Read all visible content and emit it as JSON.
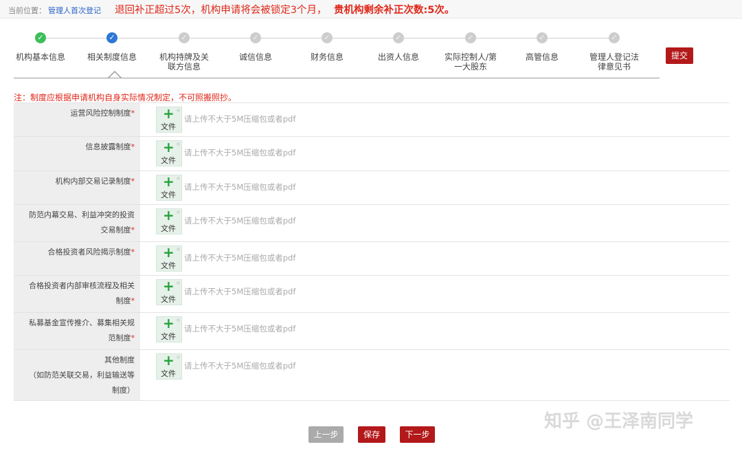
{
  "breadcrumb": {
    "label": "当前位置：",
    "link": "管理人首次登记"
  },
  "alert": {
    "text": "退回补正超过5次，机构申请将会被锁定3个月，",
    "strong": "贵机构剩余补正次数:5次。"
  },
  "steps": [
    {
      "label": "机构基本信息",
      "status": "done"
    },
    {
      "label": "相关制度信息",
      "status": "current"
    },
    {
      "label": "机构持牌及关\n联方信息",
      "status": "todo"
    },
    {
      "label": "诚信信息",
      "status": "todo"
    },
    {
      "label": "财务信息",
      "status": "todo"
    },
    {
      "label": "出资人信息",
      "status": "todo"
    },
    {
      "label": "实际控制人/第\n一大股东",
      "status": "todo"
    },
    {
      "label": "高管信息",
      "status": "todo"
    },
    {
      "label": "管理人登记法\n律意见书",
      "status": "todo"
    }
  ],
  "submit_label": "提交",
  "note": "注：制度应根据申请机构自身实际情况制定，不可照搬照抄。",
  "upload": {
    "plus": "+",
    "file_label": "文件",
    "hint": "请上传不大于5M压缩包或者pdf"
  },
  "rows": [
    {
      "label": "运营风险控制制度",
      "required": "*"
    },
    {
      "label": "信息披露制度",
      "required": "*"
    },
    {
      "label": "机构内部交易记录制度",
      "required": "*"
    },
    {
      "label": "防范内幕交易、利益冲突的投资\n交易制度",
      "required": "*"
    },
    {
      "label": "合格投资者风险揭示制度",
      "required": "*"
    },
    {
      "label": "合格投资者内部审核流程及相关\n制度",
      "required": "*"
    },
    {
      "label": "私募基金宣传推介、募集相关规\n范制度",
      "required": "*"
    },
    {
      "label": "其他制度\n（如防范关联交易，利益输送等\n制度）",
      "required": ""
    }
  ],
  "buttons": {
    "prev": "上一步",
    "save": "保存",
    "next": "下一步"
  },
  "watermark": "知乎 @王泽南同学",
  "colors": {
    "brand_red": "#b3191a",
    "alert_red": "#e0271a",
    "done_green": "#3cbf5b",
    "current_blue": "#2d77d5",
    "todo_grey": "#cdcdcd"
  }
}
